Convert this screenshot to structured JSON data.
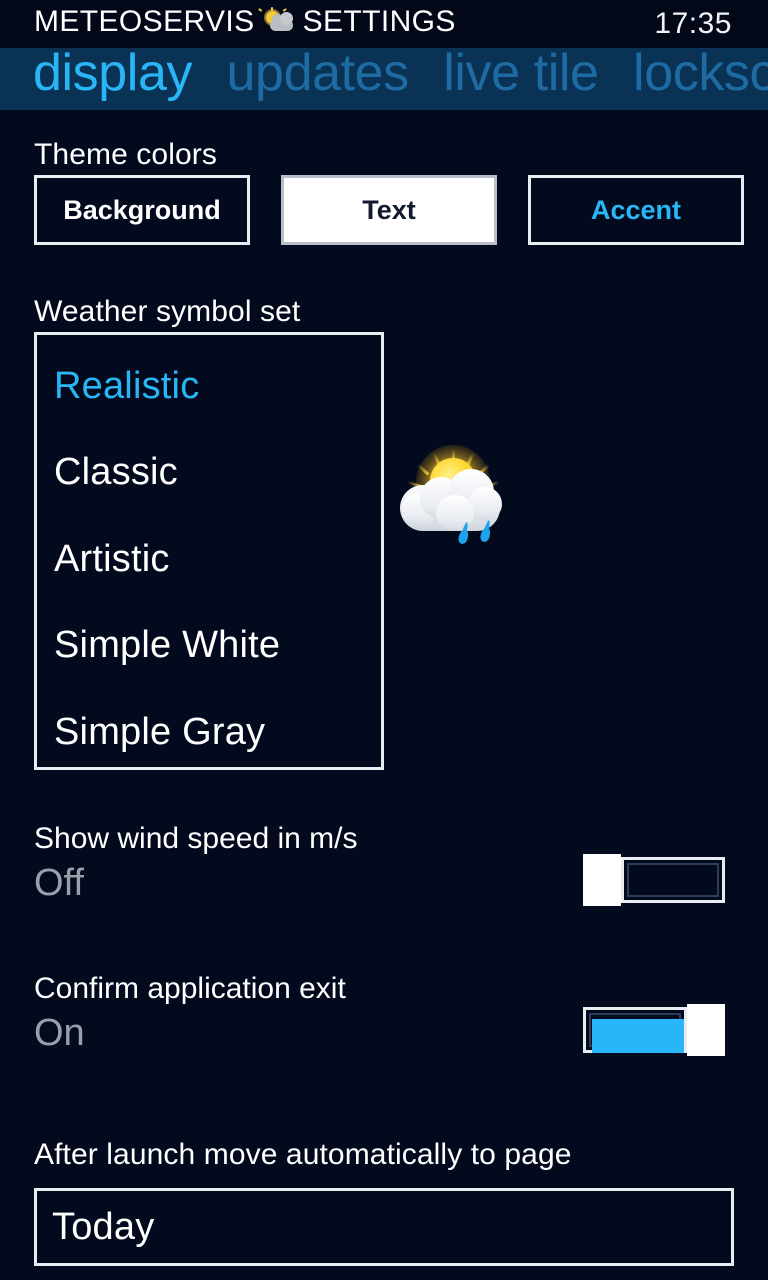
{
  "statusbar": {
    "app_title_prefix": "METEOSERVIS",
    "app_title_suffix": "SETTINGS",
    "weather_icon": "sun-behind-cloud-icon",
    "clock": "17:35"
  },
  "pivot": {
    "tabs": [
      {
        "label": "display",
        "active": true
      },
      {
        "label": "updates",
        "active": false
      },
      {
        "label": "live tile",
        "active": false
      },
      {
        "label": "locksc",
        "active": false
      }
    ]
  },
  "theme_colors": {
    "section_label": "Theme colors",
    "buttons": [
      {
        "label": "Background",
        "style": "outline"
      },
      {
        "label": "Text",
        "style": "filled"
      },
      {
        "label": "Accent",
        "style": "accent"
      }
    ]
  },
  "weather_symbol_set": {
    "section_label": "Weather symbol set",
    "options": [
      {
        "label": "Realistic",
        "selected": true
      },
      {
        "label": "Classic",
        "selected": false
      },
      {
        "label": "Artistic",
        "selected": false
      },
      {
        "label": "Simple White",
        "selected": false
      },
      {
        "label": "Simple Gray",
        "selected": false
      }
    ],
    "preview_icon": "sun-behind-rain-cloud-icon"
  },
  "wind_speed": {
    "label": "Show wind speed in m/s",
    "state": "Off",
    "on": false
  },
  "confirm_exit": {
    "label": "Confirm application exit",
    "state": "On",
    "on": true
  },
  "launch_page": {
    "label": "After launch move automatically to page",
    "value": "Today"
  },
  "colors": {
    "background": "#030a1e",
    "statusbar": "#020818",
    "pivot_band": "#0a3254",
    "accent": "#29b6f6",
    "tab_inactive": "#1e6ba3",
    "text": "#ffffff",
    "muted_text": "#9aa0a8",
    "border": "#e9ecf1"
  }
}
